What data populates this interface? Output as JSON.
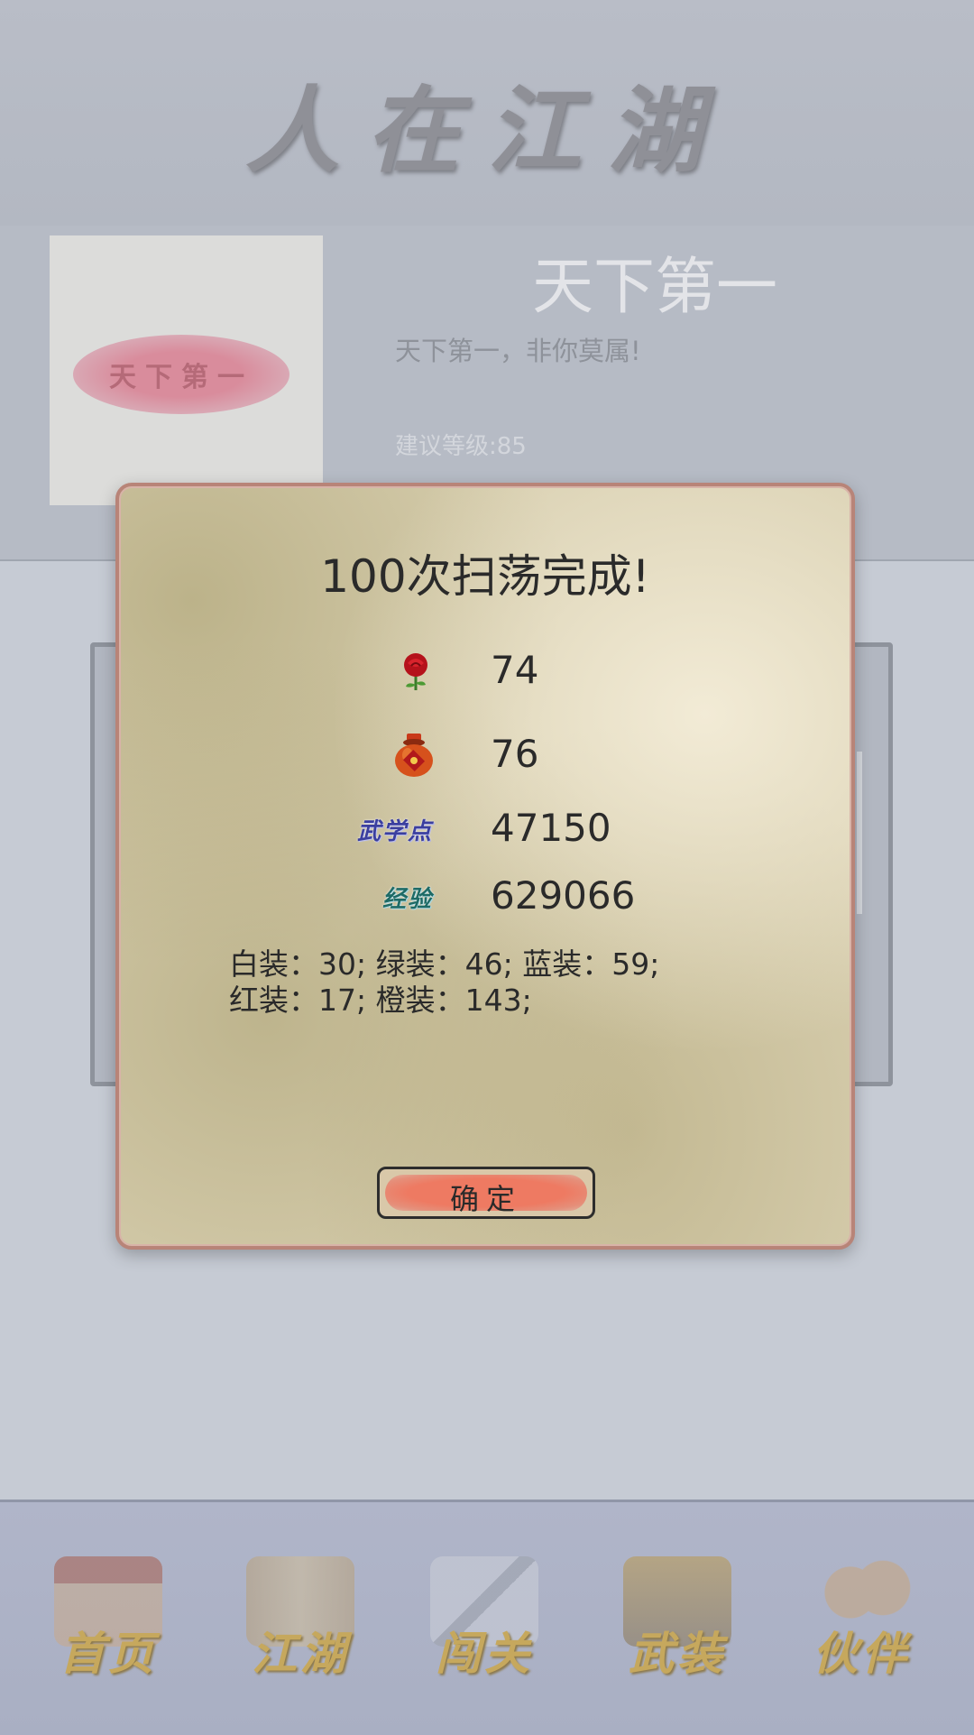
{
  "header": {
    "title": "人在江湖"
  },
  "stage": {
    "stamp_text": "天下第一",
    "name": "天下第一",
    "description": "天下第一，非你莫属!",
    "level": "建议等级:85"
  },
  "dialog": {
    "title": "100次扫荡完成!",
    "rewards": [
      {
        "icon": "rose-icon",
        "value": "74"
      },
      {
        "icon": "wine-jar-icon",
        "value": "76"
      },
      {
        "icon": "martial-points-label",
        "label": "武学点",
        "value": "47150"
      },
      {
        "icon": "experience-label",
        "label": "经验",
        "value": "629066"
      }
    ],
    "equipment_line1": "白装：30; 绿装：46; 蓝装：59;",
    "equipment_line2": "红装：17; 橙装：143;",
    "confirm_label": "确定"
  },
  "nav": {
    "items": [
      {
        "label": "首页",
        "icon": "home-temple-icon"
      },
      {
        "label": "江湖",
        "icon": "scroll-map-icon"
      },
      {
        "label": "闯关",
        "icon": "crossed-swords-icon"
      },
      {
        "label": "武装",
        "icon": "armor-icon"
      },
      {
        "label": "伙伴",
        "icon": "partners-icon"
      }
    ]
  },
  "colors": {
    "dialog_border": "#b88478",
    "confirm_button": "#ee7a62",
    "nav_label": "#c6a85d"
  }
}
